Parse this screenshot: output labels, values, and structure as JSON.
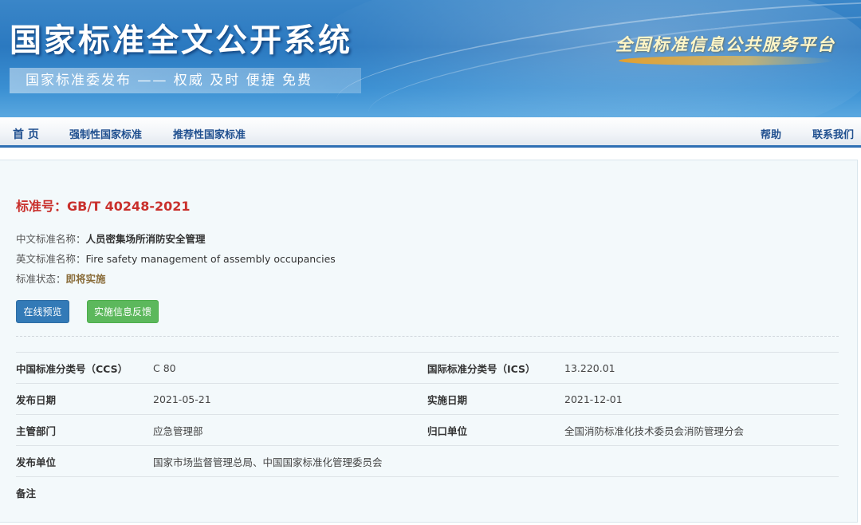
{
  "banner": {
    "site_title": "国家标准全文公开系统",
    "slogan": "国家标准委发布 —— 权威 及时 便捷 免费",
    "platform_name": "全国标准信息公共服务平台"
  },
  "nav": {
    "home": "首 页",
    "mandatory": "强制性国家标准",
    "recommended": "推荐性国家标准",
    "help": "帮助",
    "contact": "联系我们"
  },
  "standard": {
    "number_label": "标准号：GB/T 40248-2021",
    "cn_name_label": "中文标准名称：",
    "cn_name": "人员密集场所消防安全管理",
    "en_name_label": "英文标准名称：",
    "en_name": "Fire safety management of assembly occupancies",
    "status_label": "标准状态：",
    "status": "即将实施"
  },
  "buttons": {
    "preview": "在线预览",
    "feedback": "实施信息反馈"
  },
  "details": {
    "ccs_label": "中国标准分类号（CCS）",
    "ccs_value": "C 80",
    "ics_label": "国际标准分类号（ICS）",
    "ics_value": "13.220.01",
    "publish_date_label": "发布日期",
    "publish_date_value": "2021-05-21",
    "implement_date_label": "实施日期",
    "implement_date_value": "2021-12-01",
    "dept_label": "主管部门",
    "dept_value": "应急管理部",
    "owner_label": "归口单位",
    "owner_value": "全国消防标准化技术委员会消防管理分会",
    "publisher_label": "发布单位",
    "publisher_value": "国家市场监督管理总局、中国国家标准化管理委员会",
    "remark_label": "备注",
    "remark_value": ""
  },
  "colors": {
    "banner_blue": "#2b79c0",
    "nav_text": "#1f4f8f",
    "standard_number_red": "#c9302c",
    "status_brown": "#8a6d3b",
    "preview_button": "#337ab7",
    "feedback_button": "#5cb85c"
  }
}
